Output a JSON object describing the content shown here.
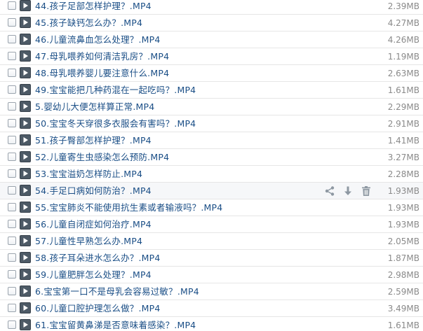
{
  "files": [
    {
      "name": "44.孩子足部怎样护理？.MP4",
      "size": "2.39MB"
    },
    {
      "name": "45.孩子缺钙怎么办？.MP4",
      "size": "4.27MB"
    },
    {
      "name": "46.儿童流鼻血怎么处理？.MP4",
      "size": "4.26MB"
    },
    {
      "name": "47.母乳喂养如何清洁乳房？.MP4",
      "size": "1.19MB"
    },
    {
      "name": "48.母乳喂养婴儿要注意什么.MP4",
      "size": "2.63MB"
    },
    {
      "name": "49.宝宝能把几种药混在一起吃吗？.MP4",
      "size": "1.61MB"
    },
    {
      "name": "5.婴幼儿大便怎样算正常.MP4",
      "size": "2.29MB"
    },
    {
      "name": "50.宝宝冬天穿很多衣服会有害吗？.MP4",
      "size": "2.91MB"
    },
    {
      "name": "51.孩子臀部怎样护理？.MP4",
      "size": "1.41MB"
    },
    {
      "name": "52.儿童寄生虫感染怎么预防.MP4",
      "size": "3.27MB"
    },
    {
      "name": "53.宝宝溢奶怎样防止.MP4",
      "size": "2.28MB"
    },
    {
      "name": "54.手足口病如何防治？.MP4",
      "size": "1.93MB",
      "hover": true
    },
    {
      "name": "55.宝宝肺炎不能使用抗生素或者输液吗？.MP4",
      "size": "1.93MB"
    },
    {
      "name": "56.儿童自闭症如何治疗.MP4",
      "size": "1.93MB"
    },
    {
      "name": "57.儿童性早熟怎么办.MP4",
      "size": "2.05MB"
    },
    {
      "name": "58.孩子耳朵进水怎么办？.MP4",
      "size": "1.87MB"
    },
    {
      "name": "59.儿童肥胖怎么处理？.MP4",
      "size": "2.98MB"
    },
    {
      "name": "6.宝宝第一口不是母乳会容易过敏？.MP4",
      "size": "2.59MB"
    },
    {
      "name": "60.儿童口腔护理怎么做？.MP4",
      "size": "3.49MB"
    },
    {
      "name": "61.宝宝留黄鼻涕是否意味着感染？.MP4",
      "size": "1.61MB"
    }
  ],
  "row_actions": {
    "icons": [
      "share-icon",
      "download-icon",
      "delete-icon"
    ]
  },
  "colors": {
    "link": "#1a4e86",
    "size": "#8a8a8a",
    "hover_bg": "#f6f7f9",
    "icon": "#8e98a2"
  }
}
